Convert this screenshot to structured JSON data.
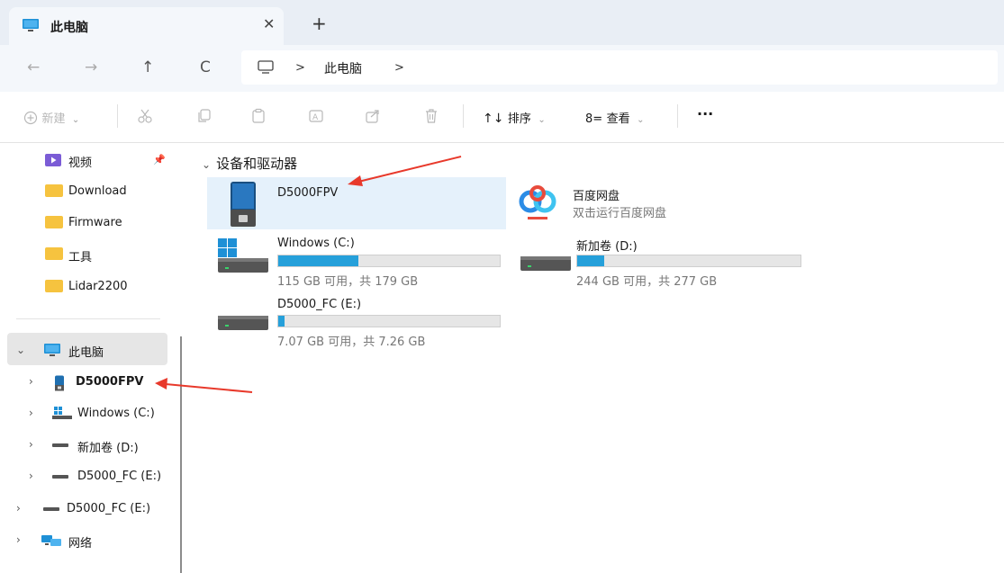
{
  "tab": {
    "title": "此电脑",
    "close_glyph": "✕",
    "new_tab_glyph": "+",
    "icon": "monitor-icon"
  },
  "nav": {
    "back_glyph": "←",
    "forward_glyph": "→",
    "up_glyph": "↑",
    "refresh_glyph": "C",
    "address": {
      "icon": "monitor-outline-icon",
      "separator": ">",
      "crumb": "此电脑"
    }
  },
  "toolbar": {
    "new_label": "新建",
    "sort_label": "排序",
    "view_label": "查看",
    "more_glyph": "···",
    "dropdown_glyph": "⌄",
    "icons": [
      "new-icon",
      "cut-icon",
      "copy-icon",
      "paste-icon",
      "rename-icon",
      "share-icon",
      "delete-icon",
      "sort-icon",
      "view-icon",
      "more-icon"
    ]
  },
  "sidebar": {
    "quick_access": [
      {
        "label": "视频",
        "icon": "video-folder-icon",
        "pinned": true
      },
      {
        "label": "Download",
        "icon": "folder-icon"
      },
      {
        "label": "Firmware",
        "icon": "folder-icon"
      },
      {
        "label": "工具",
        "icon": "folder-icon"
      },
      {
        "label": "Lidar2200",
        "icon": "folder-icon"
      }
    ],
    "this_pc": {
      "label": "此电脑",
      "expanded": true,
      "children": [
        {
          "label": "D5000FPV",
          "icon": "device-icon"
        },
        {
          "label": "Windows (C:)",
          "icon": "windows-drive-icon"
        },
        {
          "label": "新加卷 (D:)",
          "icon": "drive-icon"
        },
        {
          "label": "D5000_FC (E:)",
          "icon": "drive-icon"
        }
      ]
    },
    "other": [
      {
        "label": "D5000_FC (E:)",
        "icon": "drive-icon"
      },
      {
        "label": "网络",
        "icon": "network-icon"
      }
    ]
  },
  "main": {
    "group_title": "设备和驱动器",
    "items": [
      {
        "name": "D5000FPV",
        "type": "device",
        "selected": true
      },
      {
        "name": "百度网盘",
        "sub": "双击运行百度网盘",
        "type": "app"
      },
      {
        "name": "Windows (C:)",
        "free": "115 GB 可用，共 179 GB",
        "used_fraction": 0.36
      },
      {
        "name": "新加卷 (D:)",
        "free": "244 GB 可用，共 277 GB",
        "used_fraction": 0.12
      },
      {
        "name": "D5000_FC (E:)",
        "free": "7.07 GB 可用，共 7.26 GB",
        "used_fraction": 0.03
      }
    ]
  },
  "colors": {
    "accent": "#26a0da",
    "folder": "#f6c33f",
    "selection": "#e5f1fb",
    "annotation_arrow": "#e8392b"
  }
}
